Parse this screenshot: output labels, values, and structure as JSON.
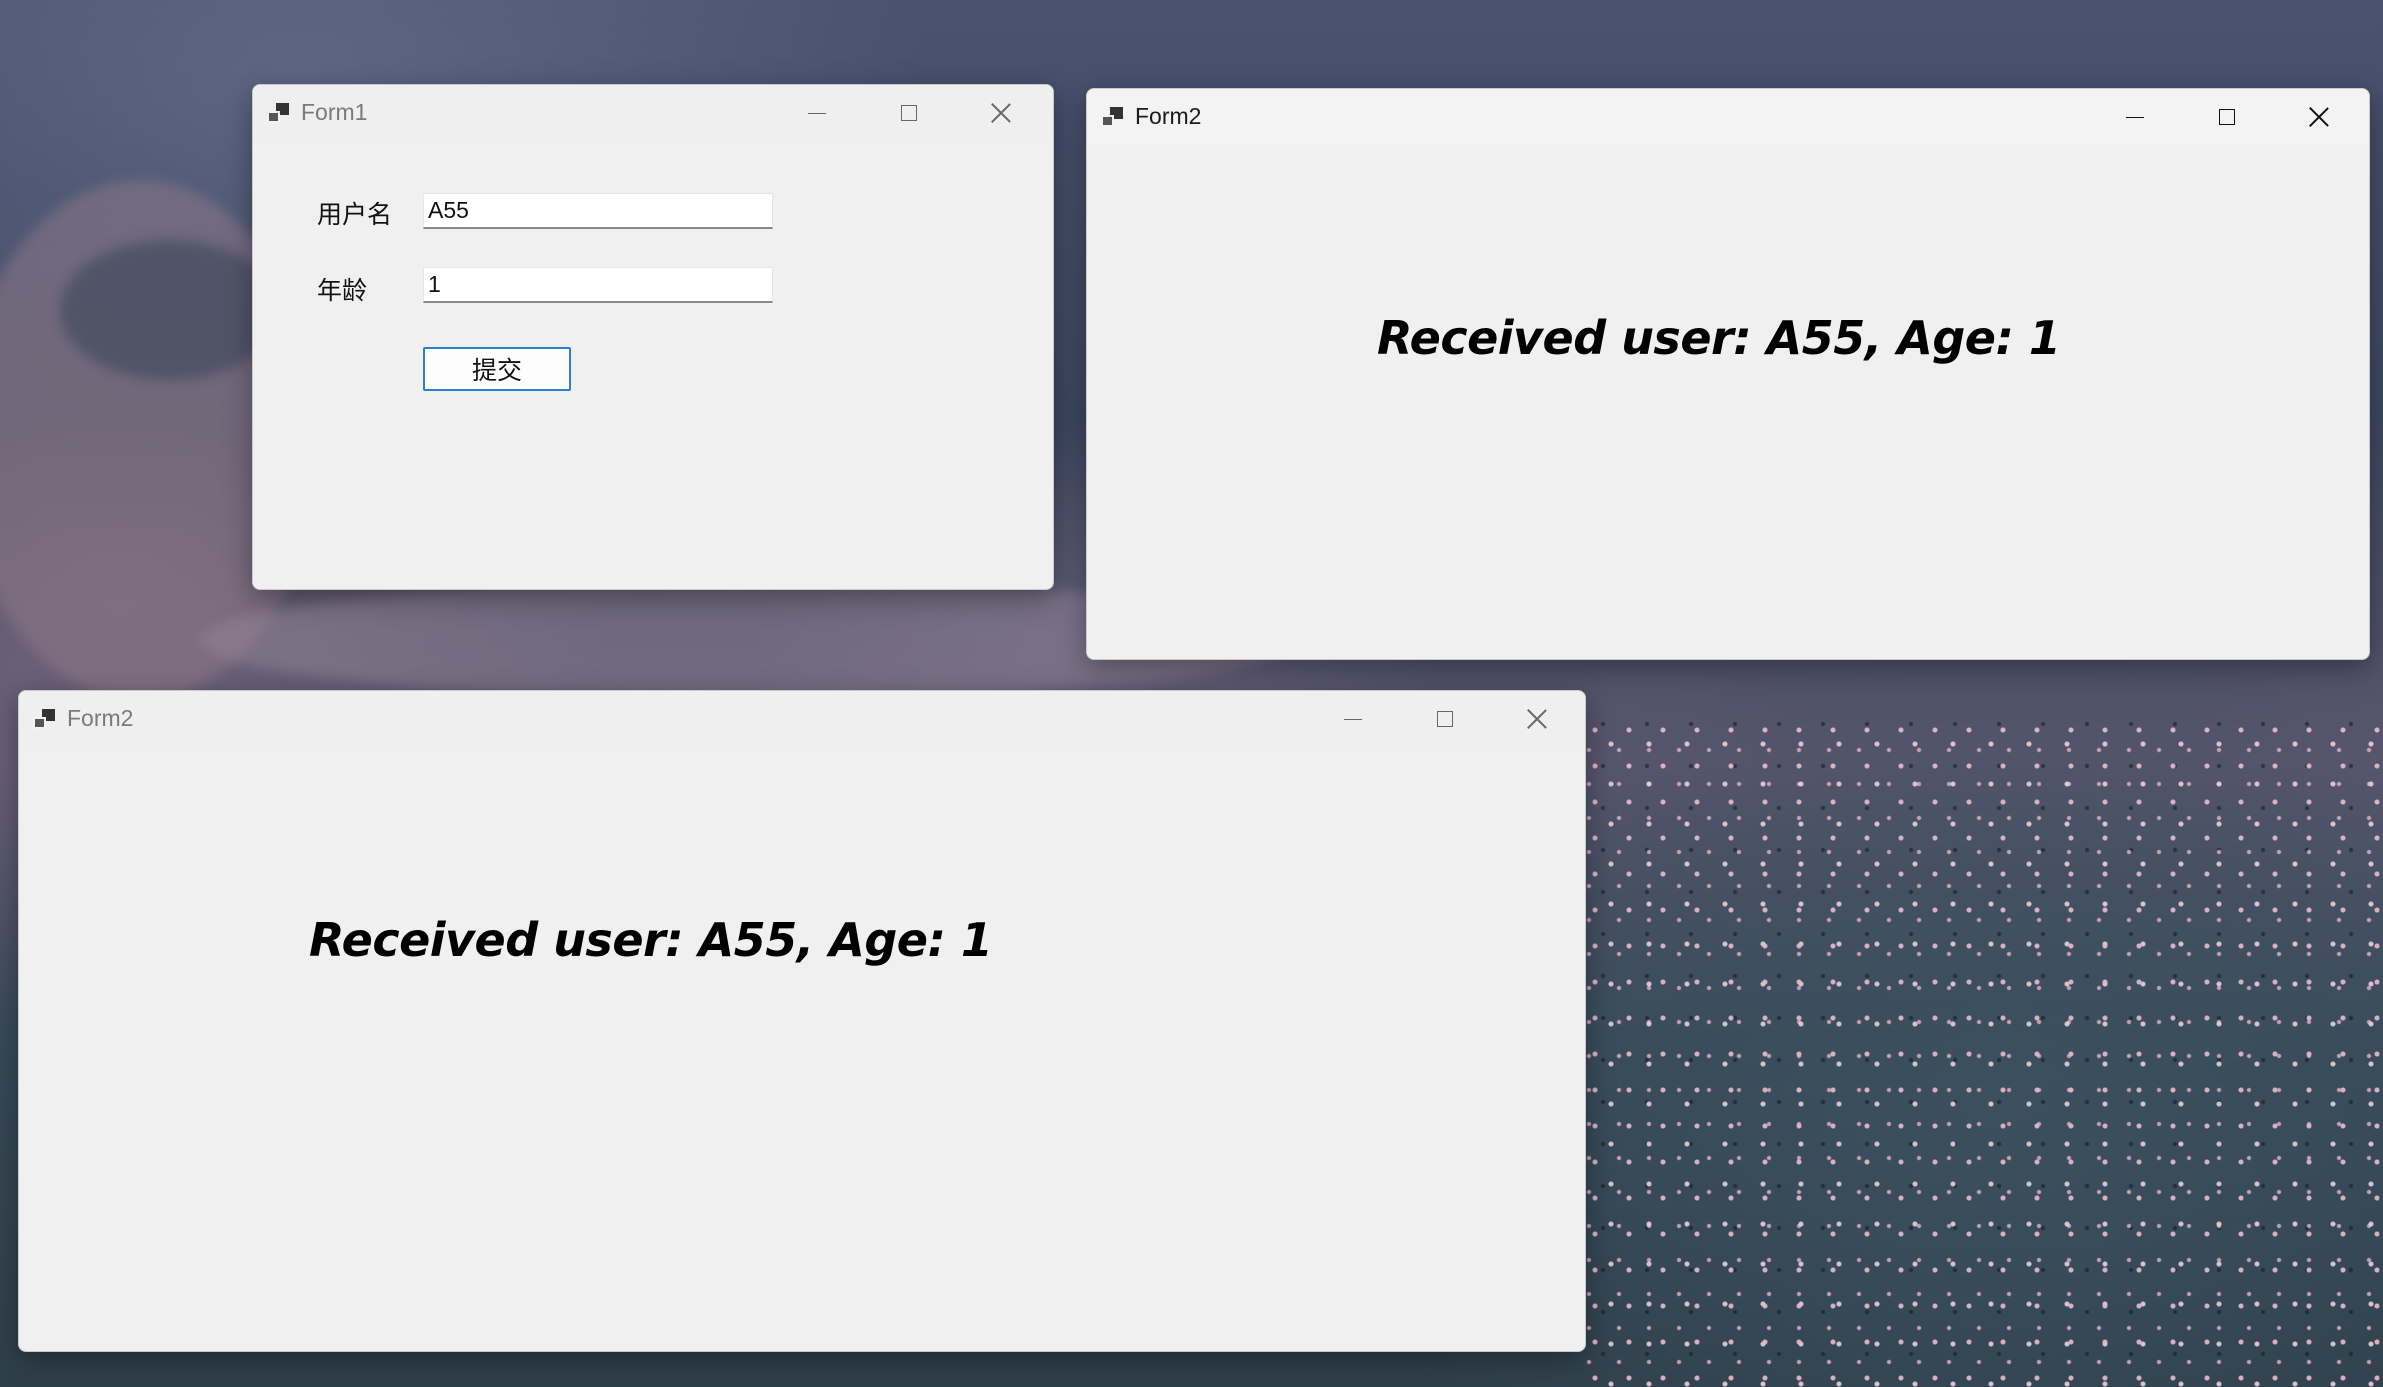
{
  "form1": {
    "title": "Form1",
    "username_label": "用户名",
    "username_value": "A55",
    "age_label": "年龄",
    "age_value": "1",
    "submit_label": "提交"
  },
  "form2_top": {
    "title": "Form2",
    "message": "Received user: A55, Age: 1"
  },
  "form2_bottom": {
    "title": "Form2",
    "message": "Received user: A55, Age: 1"
  },
  "icons": {
    "app": "winforms-app-icon",
    "minimize": "minimize-icon",
    "maximize": "maximize-icon",
    "close": "close-icon"
  },
  "colors": {
    "window_bg": "#f0f0f0",
    "button_border": "#2b7fd1",
    "message_text": "#000000"
  }
}
